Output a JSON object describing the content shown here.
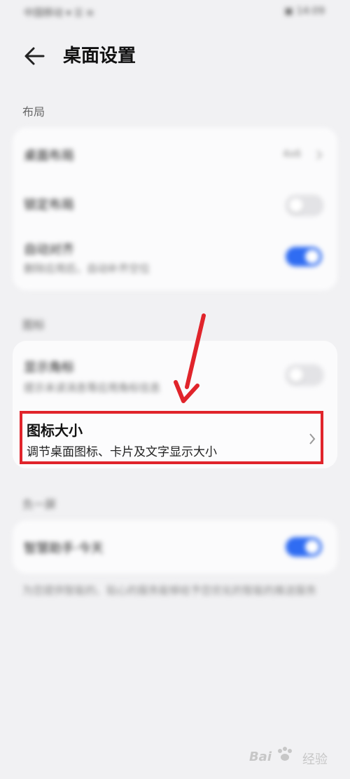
{
  "status": {
    "left": "中国移动 ▾ ☰ ≋",
    "right": "▣ 14:09"
  },
  "header": {
    "title": "桌面设置"
  },
  "sections": {
    "layout": "布局",
    "icons": "图标",
    "more": "负一屏"
  },
  "layout_card": {
    "desktop_layout": {
      "title": "桌面布局",
      "value": "4x6"
    },
    "lock_layout": {
      "title": "锁定布局",
      "toggle": "off"
    },
    "auto_align": {
      "title": "自动对齐",
      "subtitle": "删除应用后，自动补齐空位",
      "toggle": "on"
    }
  },
  "icons_card": {
    "badge": {
      "title": "显示角标",
      "subtitle": "提示未读消息等应用角标信息",
      "toggle": "off"
    },
    "icon_size": {
      "title": "图标大小",
      "subtitle": "调节桌面图标、卡片及文字显示大小"
    }
  },
  "more_card": {
    "smart_assistant": {
      "title": "智慧助手·今天",
      "toggle": "on"
    }
  },
  "footnote": "为您提供智能的、贴心的服务能够给予您优化的智能的推送服务",
  "watermark": {
    "logo": "Bai",
    "text": "经验"
  },
  "colors": {
    "accent": "#2f6cf2",
    "highlight": "#e0242b"
  }
}
